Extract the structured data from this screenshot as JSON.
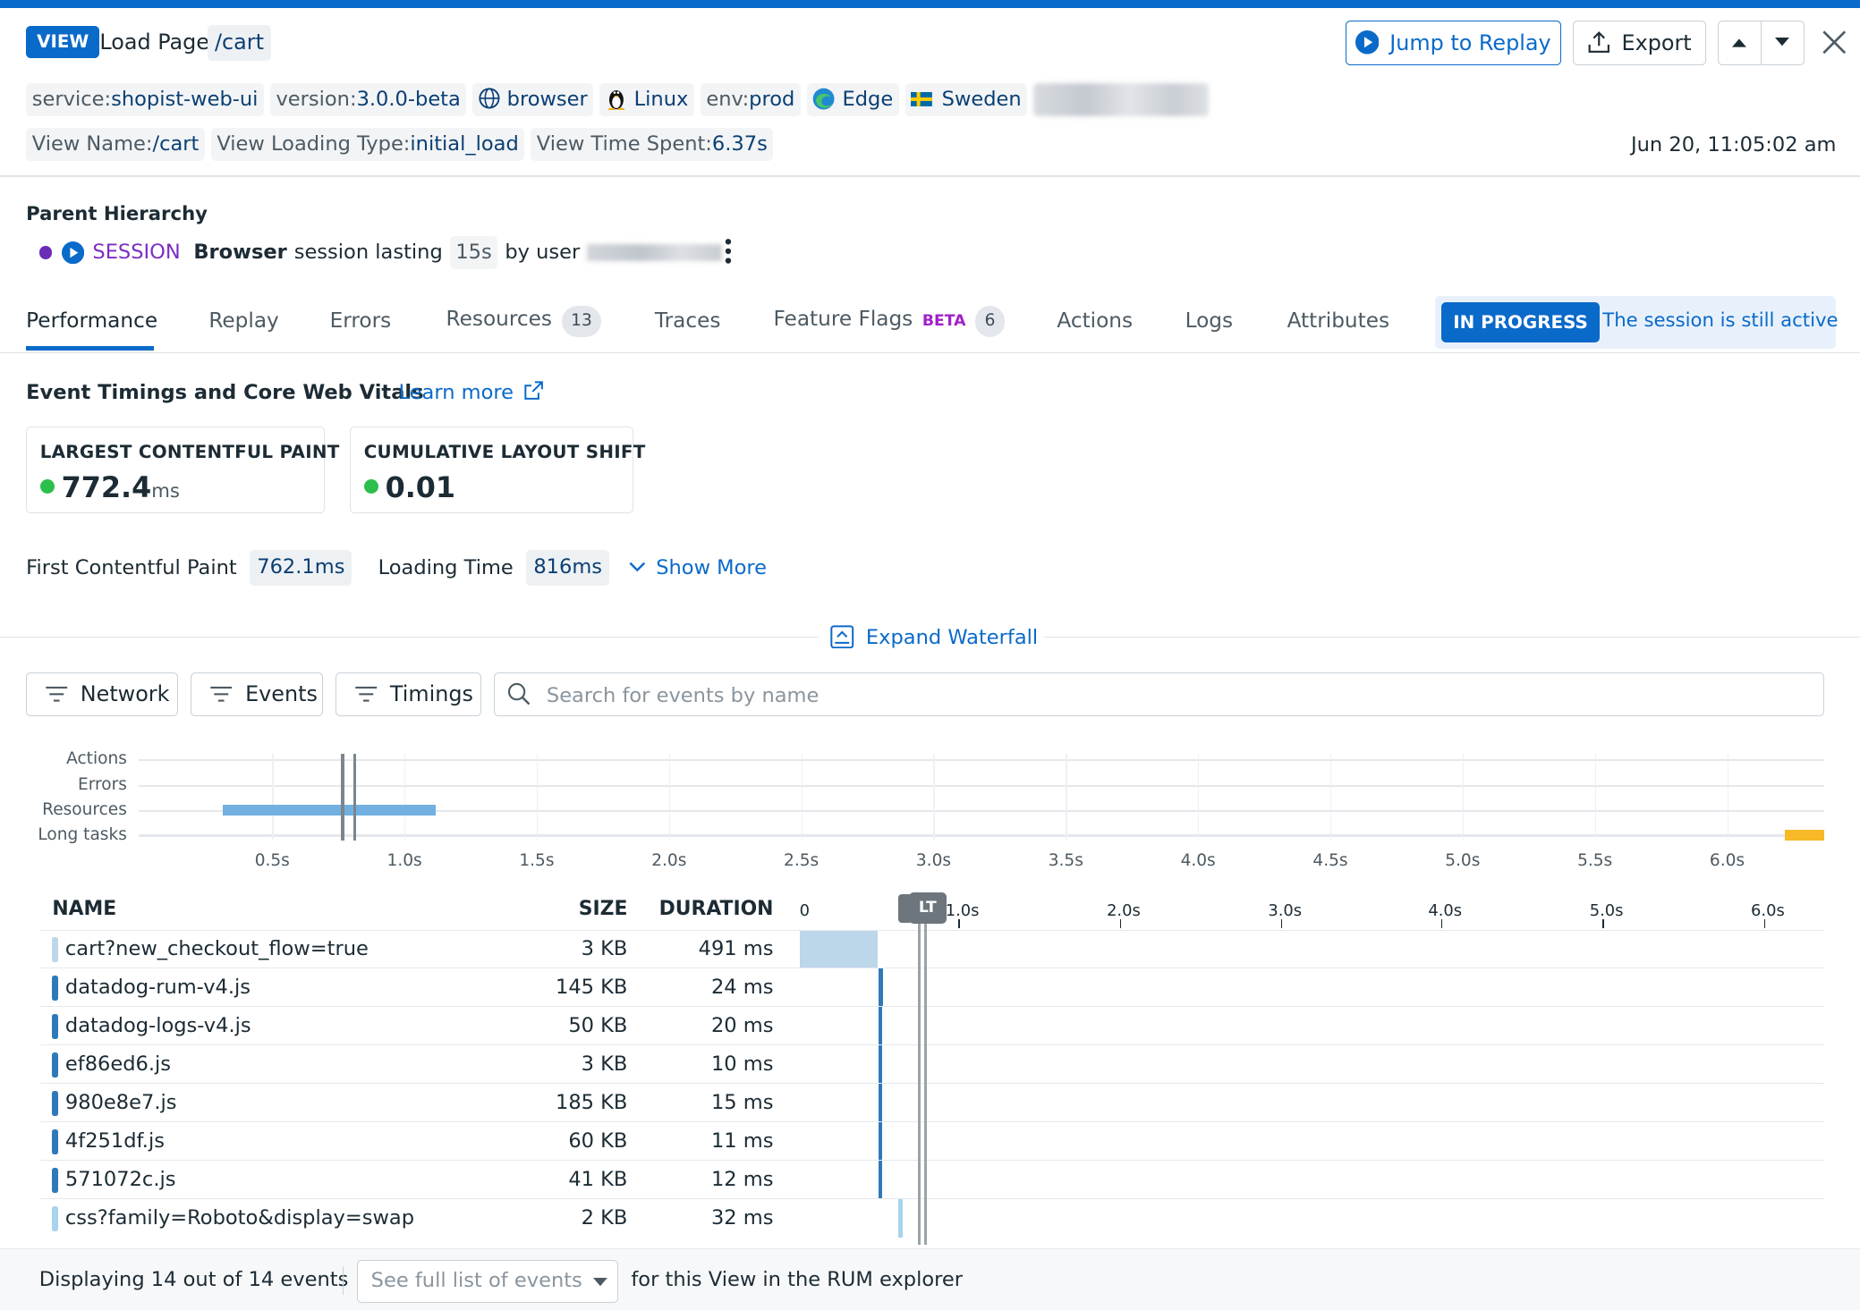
{
  "header": {
    "view_badge": "VIEW",
    "title": "Load Page",
    "path": "/cart",
    "jump_to_replay": "Jump to Replay",
    "export": "Export",
    "timestamp": "Jun 20, 11:05:02 am"
  },
  "tags": {
    "service_key": "service:",
    "service_val": "shopist-web-ui",
    "version_key": "version:",
    "version_val": "3.0.0-beta",
    "browser": "browser",
    "os": "Linux",
    "env_key": "env:",
    "env_val": "prod",
    "edge": "Edge",
    "country": "Sweden",
    "view_name_key": "View Name:",
    "view_name_val": "/cart",
    "loading_type_key": "View Loading Type:",
    "loading_type_val": "initial_load",
    "time_spent_key": "View Time Spent:",
    "time_spent_val": "6.37s"
  },
  "hierarchy": {
    "label": "Parent Hierarchy",
    "session_label": "SESSION",
    "browser_word": "Browser",
    "session_text": "session lasting",
    "duration": "15s",
    "by_user": "by user"
  },
  "tabs": [
    {
      "label": "Performance"
    },
    {
      "label": "Replay"
    },
    {
      "label": "Errors"
    },
    {
      "label": "Resources",
      "count": "13"
    },
    {
      "label": "Traces"
    },
    {
      "label": "Feature Flags",
      "badge": "BETA",
      "count": "6"
    },
    {
      "label": "Actions"
    },
    {
      "label": "Logs"
    },
    {
      "label": "Attributes"
    }
  ],
  "status": {
    "badge": "IN PROGRESS",
    "text": "The session is still active"
  },
  "vitals": {
    "section_title": "Event Timings and Core Web Vitals",
    "learn_more": "Learn more",
    "lcp_label": "LARGEST CONTENTFUL PAINT",
    "lcp_value": "772.4",
    "lcp_unit": "ms",
    "cls_label": "CUMULATIVE LAYOUT SHIFT",
    "cls_value": "0.01",
    "fcp_label": "First Contentful Paint",
    "fcp_value": "762.1ms",
    "loading_label": "Loading Time",
    "loading_value": "816ms",
    "show_more": "Show More"
  },
  "waterfall": {
    "expand_label": "Expand Waterfall",
    "filters": [
      "Network",
      "Events",
      "Timings"
    ],
    "search_placeholder": "Search for events by name",
    "timeline_rows": [
      "Actions",
      "Errors",
      "Resources",
      "Long tasks"
    ],
    "timeline_ticks": [
      "0.5s",
      "1.0s",
      "1.5s",
      "2.0s",
      "2.5s",
      "3.0s",
      "3.5s",
      "4.0s",
      "4.5s",
      "5.0s",
      "5.5s",
      "6.0s"
    ],
    "table_ticks": [
      "0",
      "1.0s",
      "2.0s",
      "3.0s",
      "4.0s",
      "5.0s",
      "6.0s"
    ],
    "lt_marker": "LT",
    "columns": {
      "name": "NAME",
      "size": "SIZE",
      "duration": "DURATION"
    },
    "rows": [
      {
        "name": "cart?new_checkout_flow=true",
        "size": "3 KB",
        "duration": "491 ms",
        "color": "#bcd6ea"
      },
      {
        "name": "datadog-rum-v4.js",
        "size": "145 KB",
        "duration": "24 ms",
        "color": "#2f79b9"
      },
      {
        "name": "datadog-logs-v4.js",
        "size": "50 KB",
        "duration": "20 ms",
        "color": "#2f79b9"
      },
      {
        "name": "ef86ed6.js",
        "size": "3 KB",
        "duration": "10 ms",
        "color": "#2f79b9"
      },
      {
        "name": "980e8e7.js",
        "size": "185 KB",
        "duration": "15 ms",
        "color": "#2f79b9"
      },
      {
        "name": "4f251df.js",
        "size": "60 KB",
        "duration": "11 ms",
        "color": "#2f79b9"
      },
      {
        "name": "571072c.js",
        "size": "41 KB",
        "duration": "12 ms",
        "color": "#2f79b9"
      },
      {
        "name": "css?family=Roboto&display=swap",
        "size": "2 KB",
        "duration": "32 ms",
        "color": "#a9d3ee"
      }
    ]
  },
  "footer": {
    "displaying": "Displaying 14 out of 14 events",
    "select_value": "See full list of events",
    "suffix": "for this View in the RUM explorer"
  }
}
